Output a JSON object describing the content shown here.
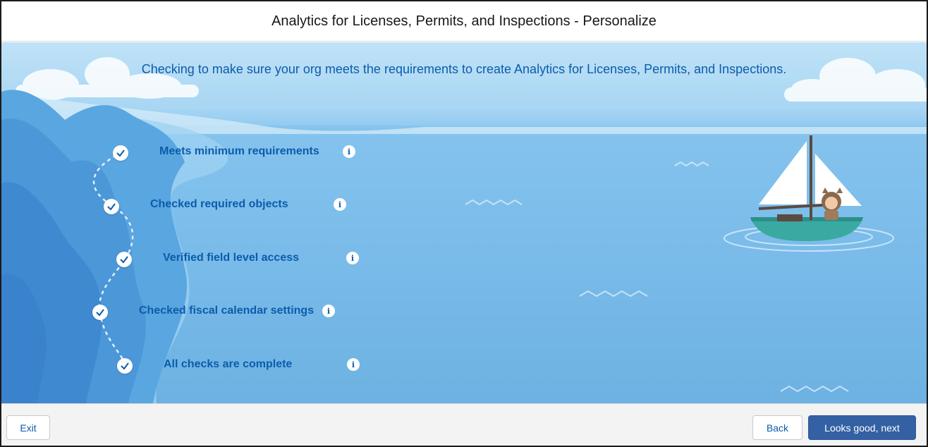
{
  "header": {
    "title": "Analytics for Licenses, Permits, and Inspections - Personalize"
  },
  "intro": "Checking to make sure your org meets the requirements to create Analytics for Licenses, Permits, and Inspections.",
  "steps": [
    {
      "label": "Meets minimum requirements",
      "status": "complete",
      "icon": "check-icon",
      "info_icon": "info-icon"
    },
    {
      "label": "Checked required objects",
      "status": "complete",
      "icon": "check-icon",
      "info_icon": "info-icon"
    },
    {
      "label": "Verified field level access",
      "status": "complete",
      "icon": "check-icon",
      "info_icon": "info-icon"
    },
    {
      "label": "Checked fiscal calendar settings",
      "status": "complete",
      "icon": "check-icon",
      "info_icon": "info-icon"
    },
    {
      "label": "All checks are complete",
      "status": "complete",
      "icon": "check-icon",
      "info_icon": "info-icon"
    }
  ],
  "info_glyph": "i",
  "footer": {
    "exit_label": "Exit",
    "back_label": "Back",
    "next_label": "Looks good, next"
  },
  "colors": {
    "brand": "#3361a3",
    "text_blue": "#0b5cab",
    "sky": "#bfe2f7",
    "water": "#6aaedf"
  }
}
